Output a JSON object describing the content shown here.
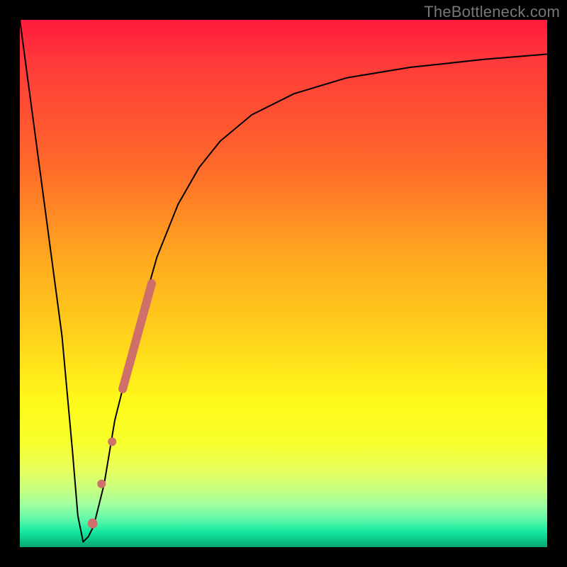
{
  "watermark": {
    "text": "TheBottleneck.com"
  },
  "chart_data": {
    "type": "line",
    "title": "",
    "xlabel": "",
    "ylabel": "",
    "xlim": [
      0,
      100
    ],
    "ylim": [
      0,
      100
    ],
    "grid": false,
    "background": "heat-gradient",
    "series": [
      {
        "name": "curve",
        "x": [
          0,
          4,
          8,
          10,
          11,
          12,
          13,
          14,
          16,
          18,
          20,
          22,
          24,
          26,
          28,
          30,
          34,
          38,
          44,
          52,
          62,
          74,
          88,
          100
        ],
        "y": [
          100,
          70,
          40,
          18,
          6,
          1,
          2,
          4,
          12,
          24,
          32,
          40,
          48,
          55,
          60,
          65,
          72,
          77,
          82,
          86,
          89,
          91,
          92.5,
          93.5
        ],
        "stroke": "#000000",
        "stroke_width": 2
      }
    ],
    "markers": [
      {
        "name": "thick-segment",
        "shape": "line",
        "x1": 19.5,
        "y1": 30,
        "x2": 25,
        "y2": 50,
        "color": "#cf6f6a",
        "width": 12,
        "cap": "round"
      },
      {
        "name": "dot-1",
        "shape": "circle",
        "cx": 17.5,
        "cy": 20,
        "r": 6,
        "color": "#cf6f6a"
      },
      {
        "name": "dot-2",
        "shape": "circle",
        "cx": 15.5,
        "cy": 12,
        "r": 6,
        "color": "#cf6f6a"
      },
      {
        "name": "dot-3",
        "shape": "circle",
        "cx": 13.8,
        "cy": 4.5,
        "r": 7,
        "color": "#cf6f6a"
      }
    ]
  }
}
